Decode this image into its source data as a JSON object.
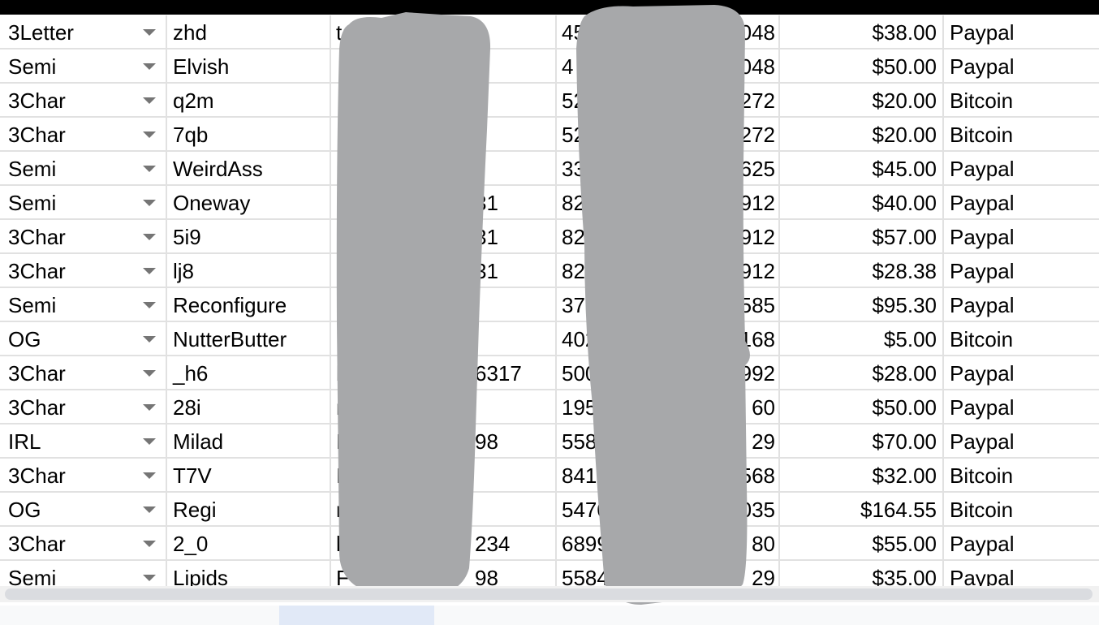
{
  "rows": [
    {
      "type": "3Letter",
      "name": "zhd",
      "col3_left": "t",
      "col3_right": "",
      "col4_left": "45",
      "col4_right": "048",
      "price": "$38.00",
      "payment": "Paypal"
    },
    {
      "type": "Semi",
      "name": "Elvish",
      "col3_left": "",
      "col3_right": "",
      "col4_left": "4",
      "col4_right": "048",
      "price": "$50.00",
      "payment": "Paypal"
    },
    {
      "type": "3Char",
      "name": "q2m",
      "col3_left": "",
      "col3_right": "",
      "col4_left": "52",
      "col4_right": "272",
      "price": "$20.00",
      "payment": "Bitcoin"
    },
    {
      "type": "3Char",
      "name": "7qb",
      "col3_left": "",
      "col3_right": "",
      "col4_left": "52",
      "col4_right": "272",
      "price": "$20.00",
      "payment": "Bitcoin"
    },
    {
      "type": "Semi",
      "name": "WeirdAss",
      "col3_left": "",
      "col3_right": "",
      "col4_left": "33",
      "col4_right": "625",
      "price": "$45.00",
      "payment": "Paypal"
    },
    {
      "type": "Semi",
      "name": "Oneway",
      "col3_left": "",
      "col3_right": "31",
      "col4_left": "823",
      "col4_right": "912",
      "price": "$40.00",
      "payment": "Paypal"
    },
    {
      "type": "3Char",
      "name": "5i9",
      "col3_left": "",
      "col3_right": "31",
      "col4_left": "823",
      "col4_right": "912",
      "price": "$57.00",
      "payment": "Paypal"
    },
    {
      "type": "3Char",
      "name": "lj8",
      "col3_left": "",
      "col3_right": "31",
      "col4_left": "823",
      "col4_right": "912",
      "price": "$28.38",
      "payment": "Paypal"
    },
    {
      "type": "Semi",
      "name": "Reconfigure",
      "col3_left": "",
      "col3_right": "",
      "col4_left": "373",
      "col4_right": "585",
      "price": "$95.30",
      "payment": "Paypal"
    },
    {
      "type": "OG",
      "name": "NutterButter",
      "col3_left": "",
      "col3_right": "",
      "col4_left": "402",
      "col4_right": "168",
      "price": "$5.00",
      "payment": "Bitcoin"
    },
    {
      "type": "3Char",
      "name": "_h6",
      "col3_left": "l",
      "col3_right": "6317",
      "col4_left": "500",
      "col4_right": "992",
      "price": "$28.00",
      "payment": "Paypal"
    },
    {
      "type": "3Char",
      "name": "28i",
      "col3_left": "n",
      "col3_right": "",
      "col4_left": "195",
      "col4_right": "60",
      "price": "$50.00",
      "payment": "Paypal"
    },
    {
      "type": "IRL",
      "name": "Milad",
      "col3_left": "F",
      "col3_right": "98",
      "col4_left": "558",
      "col4_right": "29",
      "price": "$70.00",
      "payment": "Paypal"
    },
    {
      "type": "3Char",
      "name": "T7V",
      "col3_left": "I",
      "col3_right": "",
      "col4_left": "8419",
      "col4_right": "568",
      "price": "$32.00",
      "payment": "Bitcoin"
    },
    {
      "type": "OG",
      "name": "Regi",
      "col3_left": "n",
      "col3_right": "",
      "col4_left": "5470",
      "col4_right": "035",
      "price": "$164.55",
      "payment": "Bitcoin"
    },
    {
      "type": "3Char",
      "name": "2_0",
      "col3_left": "l",
      "col3_right": "234",
      "col4_left": "6899",
      "col4_right": "80",
      "price": "$55.00",
      "payment": "Paypal"
    },
    {
      "type": "Semi",
      "name": "Lipids",
      "col3_left": "F",
      "col3_right": "98",
      "col4_left": "5584",
      "col4_right": "29",
      "price": "$35.00",
      "payment": "Paypal"
    }
  ],
  "icons": {
    "dropdown": "chevron-down-icon"
  },
  "colors": {
    "redaction": "#a7a8aa",
    "gridline": "#e1e1e1",
    "active_tab": "#e1e9f7"
  }
}
